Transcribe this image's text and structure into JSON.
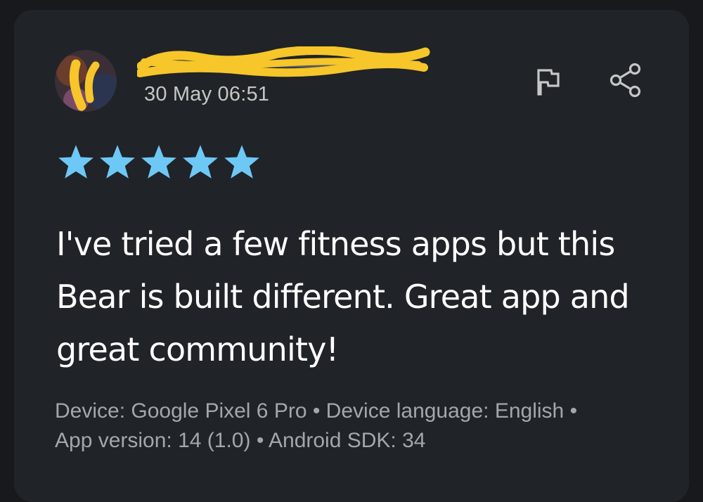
{
  "review": {
    "date": "30 May 06:51",
    "rating": 5,
    "text": "I've tried a few fitness apps but this Bear is built different. Great app and great community!",
    "device_info_line1": "Device: Google Pixel 6 Pro • Device language: English •",
    "device_info_line2": "App version: 14 (1.0) • Android SDK: 34"
  },
  "icons": {
    "flag": "flag-icon",
    "share": "share-icon",
    "star": "star-icon"
  },
  "colors": {
    "background": "#17191c",
    "card": "#202327",
    "star": "#6ec8f5",
    "redaction": "#f6c62a",
    "text_primary": "#ffffff",
    "text_secondary": "#a3a7ad"
  }
}
